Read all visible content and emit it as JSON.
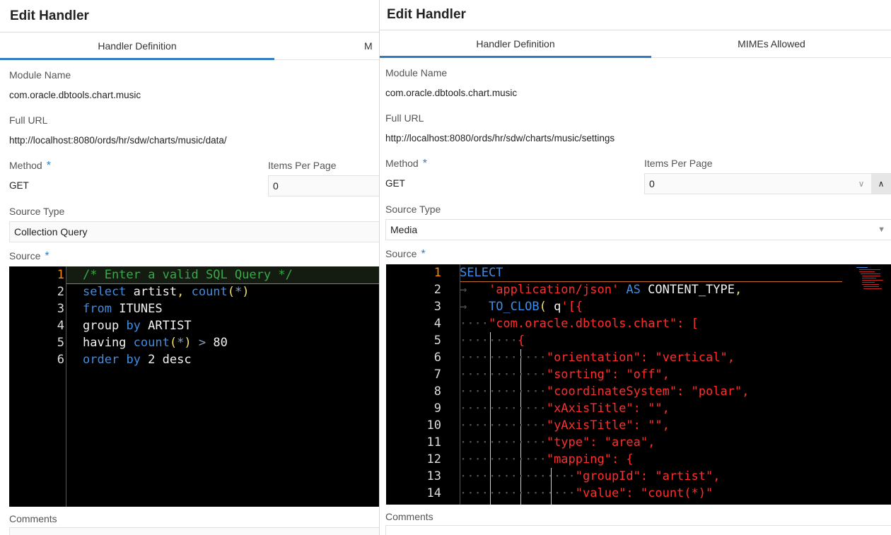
{
  "left": {
    "header_title": "Edit Handler",
    "tabs": {
      "definition": "Handler Definition",
      "mimes_partial": "M"
    },
    "module_name": {
      "label": "Module Name",
      "value": "com.oracle.dbtools.chart.music"
    },
    "full_url": {
      "label": "Full URL",
      "value": "http://localhost:8080/ords/hr/sdw/charts/music/data/"
    },
    "method": {
      "label": "Method",
      "value": "GET"
    },
    "items_per_page": {
      "label": "Items Per Page",
      "value": "0"
    },
    "source_type": {
      "label": "Source Type",
      "value": "Collection Query"
    },
    "source": {
      "label": "Source"
    },
    "editor": {
      "line_numbers": [
        "1",
        "2",
        "3",
        "4",
        "5",
        "6"
      ],
      "line1": "/* Enter a valid SQL Query */",
      "l2_select": "select",
      "l2_artist": "artist",
      "l2_comma": ",",
      "l2_count": "count",
      "l2_open": "(",
      "l2_star": "*",
      "l2_close": ")",
      "l3_from": "from",
      "l3_itunes": "ITUNES",
      "l4_group": "group",
      "l4_by": "by",
      "l4_artist": "ARTIST",
      "l5_having": "having",
      "l5_count": "count",
      "l5_open": "(",
      "l5_star": "*",
      "l5_close": ")",
      "l5_gt": ">",
      "l5_num": "80",
      "l6_order": "order",
      "l6_by": "by",
      "l6_num": "2",
      "l6_desc": "desc"
    },
    "comments": {
      "label": "Comments"
    }
  },
  "right": {
    "header_title": "Edit Handler",
    "tabs": {
      "definition": "Handler Definition",
      "mimes": "MIMEs Allowed"
    },
    "module_name": {
      "label": "Module Name",
      "value": "com.oracle.dbtools.chart.music"
    },
    "full_url": {
      "label": "Full URL",
      "value": "http://localhost:8080/ords/hr/sdw/charts/music/settings"
    },
    "method": {
      "label": "Method",
      "value": "GET"
    },
    "items_per_page": {
      "label": "Items Per Page",
      "value": "0"
    },
    "source_type": {
      "label": "Source Type",
      "value": "Media"
    },
    "source": {
      "label": "Source"
    },
    "editor": {
      "line_numbers": [
        "1",
        "2",
        "3",
        "4",
        "5",
        "6",
        "7",
        "8",
        "9",
        "10",
        "11",
        "12",
        "13",
        "14"
      ],
      "l1_select": "SELECT",
      "l2_str": "'application/json'",
      "l2_as": "AS",
      "l2_ct": "CONTENT_TYPE",
      "l2_comma": ",",
      "l3_func": "TO_CLOB",
      "l3_open": "(",
      "l3_q": "q",
      "l3_str": "'[{",
      "l4": "\"com.oracle.dbtools.chart\": [",
      "l5": "{",
      "l6": "\"orientation\": \"vertical\",",
      "l7": "\"sorting\": \"off\",",
      "l8": "\"coordinateSystem\": \"polar\",",
      "l9": "\"xAxisTitle\": \"\",",
      "l10": "\"yAxisTitle\": \"\",",
      "l11": "\"type\": \"area\",",
      "l12": "\"mapping\": {",
      "l13": "\"groupId\": \"artist\",",
      "l14": "\"value\": \"count(*)\""
    },
    "comments": {
      "label": "Comments"
    }
  },
  "icons": {
    "required": "*",
    "chevron_down": "∨",
    "chevron_up": "∧",
    "dropdown_caret": "▼"
  },
  "colors": {
    "accent": "#2f7cc0",
    "current_line_number": "#ff8c00",
    "sql_keyword": "#3d8de8",
    "string": "#ff2d2d",
    "comment": "#3aa84a"
  }
}
